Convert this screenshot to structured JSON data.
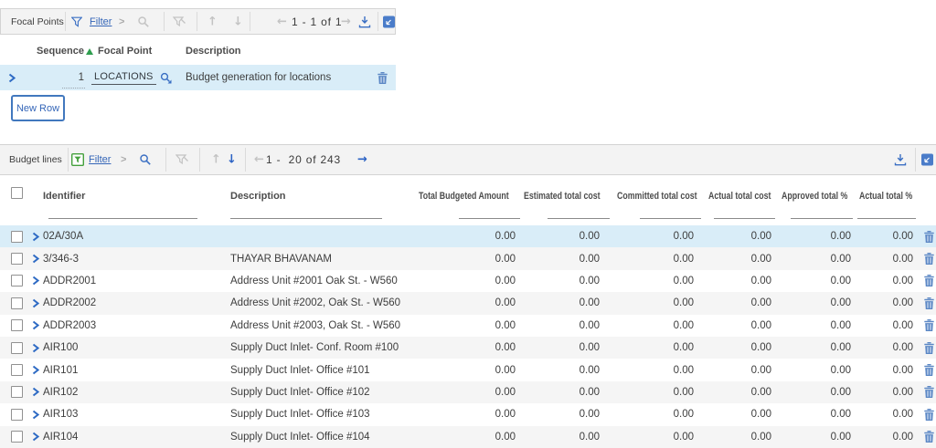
{
  "focal_points": {
    "title": "Focal Points",
    "toolbar": {
      "filter_label": "Filter",
      "pagination": "1 - 1 of 1"
    },
    "columns": {
      "sequence": "Sequence",
      "focal_point": "Focal Point",
      "description": "Description"
    },
    "row": {
      "sequence": "1",
      "focal_point": "LOCATIONS",
      "description": "Budget generation for locations"
    },
    "new_row_label": "New Row"
  },
  "budget_lines": {
    "title": "Budget lines",
    "toolbar": {
      "filter_label": "Filter",
      "pagination": "1 -  20 of 243"
    },
    "columns": {
      "identifier": "Identifier",
      "description": "Description",
      "total_budgeted_amount": "Total Budgeted Amount",
      "estimated_total_cost": "Estimated total cost",
      "committed_total_cost": "Committed total cost",
      "actual_total_cost": "Actual total cost",
      "approved_total_pct": "Approved total %",
      "actual_total_pct": "Actual total %"
    },
    "rows": [
      {
        "identifier": "02A/30A",
        "description": "",
        "total_budgeted_amount": "0.00",
        "estimated_total_cost": "0.00",
        "committed_total_cost": "0.00",
        "actual_total_cost": "0.00",
        "approved_total_pct": "0.00",
        "actual_total_pct": "0.00",
        "selected": true
      },
      {
        "identifier": "3/346-3",
        "description": "THAYAR BHAVANAM",
        "total_budgeted_amount": "0.00",
        "estimated_total_cost": "0.00",
        "committed_total_cost": "0.00",
        "actual_total_cost": "0.00",
        "approved_total_pct": "0.00",
        "actual_total_pct": "0.00",
        "selected": false
      },
      {
        "identifier": "ADDR2001",
        "description": "Address Unit #2001 Oak St. - W560",
        "total_budgeted_amount": "0.00",
        "estimated_total_cost": "0.00",
        "committed_total_cost": "0.00",
        "actual_total_cost": "0.00",
        "approved_total_pct": "0.00",
        "actual_total_pct": "0.00",
        "selected": false
      },
      {
        "identifier": "ADDR2002",
        "description": "Address Unit #2002, Oak St. - W560",
        "total_budgeted_amount": "0.00",
        "estimated_total_cost": "0.00",
        "committed_total_cost": "0.00",
        "actual_total_cost": "0.00",
        "approved_total_pct": "0.00",
        "actual_total_pct": "0.00",
        "selected": false
      },
      {
        "identifier": "ADDR2003",
        "description": "Address Unit #2003, Oak St. - W560",
        "total_budgeted_amount": "0.00",
        "estimated_total_cost": "0.00",
        "committed_total_cost": "0.00",
        "actual_total_cost": "0.00",
        "approved_total_pct": "0.00",
        "actual_total_pct": "0.00",
        "selected": false
      },
      {
        "identifier": "AIR100",
        "description": "Supply Duct Inlet- Conf. Room #100",
        "total_budgeted_amount": "0.00",
        "estimated_total_cost": "0.00",
        "committed_total_cost": "0.00",
        "actual_total_cost": "0.00",
        "approved_total_pct": "0.00",
        "actual_total_pct": "0.00",
        "selected": false
      },
      {
        "identifier": "AIR101",
        "description": "Supply Duct Inlet- Office #101",
        "total_budgeted_amount": "0.00",
        "estimated_total_cost": "0.00",
        "committed_total_cost": "0.00",
        "actual_total_cost": "0.00",
        "approved_total_pct": "0.00",
        "actual_total_pct": "0.00",
        "selected": false
      },
      {
        "identifier": "AIR102",
        "description": "Supply Duct Inlet- Office #102",
        "total_budgeted_amount": "0.00",
        "estimated_total_cost": "0.00",
        "committed_total_cost": "0.00",
        "actual_total_cost": "0.00",
        "approved_total_pct": "0.00",
        "actual_total_pct": "0.00",
        "selected": false
      },
      {
        "identifier": "AIR103",
        "description": "Supply Duct Inlet- Office #103",
        "total_budgeted_amount": "0.00",
        "estimated_total_cost": "0.00",
        "committed_total_cost": "0.00",
        "actual_total_cost": "0.00",
        "approved_total_pct": "0.00",
        "actual_total_pct": "0.00",
        "selected": false
      },
      {
        "identifier": "AIR104",
        "description": "Supply Duct Inlet- Office #104",
        "total_budgeted_amount": "0.00",
        "estimated_total_cost": "0.00",
        "committed_total_cost": "0.00",
        "actual_total_cost": "0.00",
        "approved_total_pct": "0.00",
        "actual_total_pct": "0.00",
        "selected": false
      }
    ]
  },
  "colors": {
    "accent_blue": "#3a6fc3",
    "link_blue": "#3566b8",
    "selected_row": "#d9edf8",
    "alt_row": "#f5f5f5",
    "toolbar_bg": "#f3f3f3",
    "sort_green": "#2f9e4f",
    "filter_green": "#44a03c",
    "trash_blue": "#5b87c5"
  },
  "icons": [
    "filter-funnel-icon",
    "filter-table-icon",
    "search-icon",
    "clear-filter-icon",
    "previous-row-icon",
    "next-row-icon",
    "previous-page-icon",
    "next-page-icon",
    "download-icon",
    "maximize-icon",
    "trash-icon",
    "expand-row-icon",
    "sort-ascending-icon",
    "lookup-icon",
    "checkbox"
  ]
}
